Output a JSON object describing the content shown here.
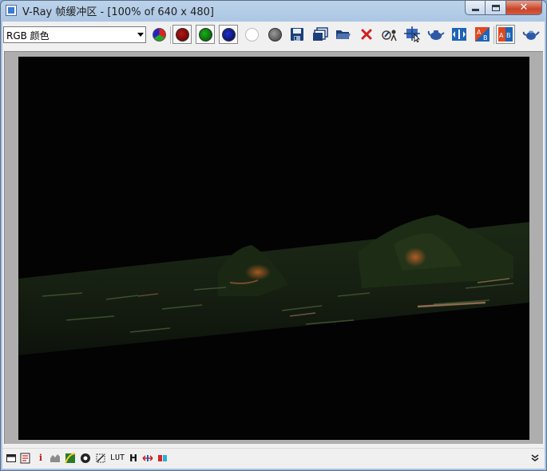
{
  "window": {
    "title": "V-Ray 帧缓冲区 - [100% of 640 x 480]",
    "controls": {
      "minimize": "minimize",
      "maximize": "maximize",
      "close": "✕"
    }
  },
  "toolbar": {
    "channel_select": {
      "value": "RGB 颜色"
    },
    "buttons": [
      "rgb-display-icon",
      "red-channel-icon",
      "green-channel-icon",
      "blue-channel-icon",
      "alpha-channel-icon",
      "monochrome-icon",
      "save-image-icon",
      "clone-frame-buffer-icon",
      "load-image-icon",
      "clear-image-icon",
      "track-mouse-icon",
      "region-render-icon",
      "render-last-icon",
      "ab-compare-icon",
      "a-b-horizontal-icon",
      "a-b-vertical-icon",
      "render-teapot-icon"
    ],
    "pressed_buttons": [
      "red-channel-icon",
      "green-channel-icon",
      "blue-channel-icon"
    ]
  },
  "render": {
    "background": "#030303",
    "resolution_label": "640 x 480",
    "zoom": "100%"
  },
  "statusbar": {
    "info_letter": "i",
    "lut_label": "LUT",
    "histogram_letter": "H",
    "expand_glyph": "⌄"
  },
  "colors": {
    "title_bar": "#a9c4e2",
    "close_button": "#c8452a",
    "client_bg": "#f0f0f0",
    "frame_bg": "#aeaeae"
  }
}
